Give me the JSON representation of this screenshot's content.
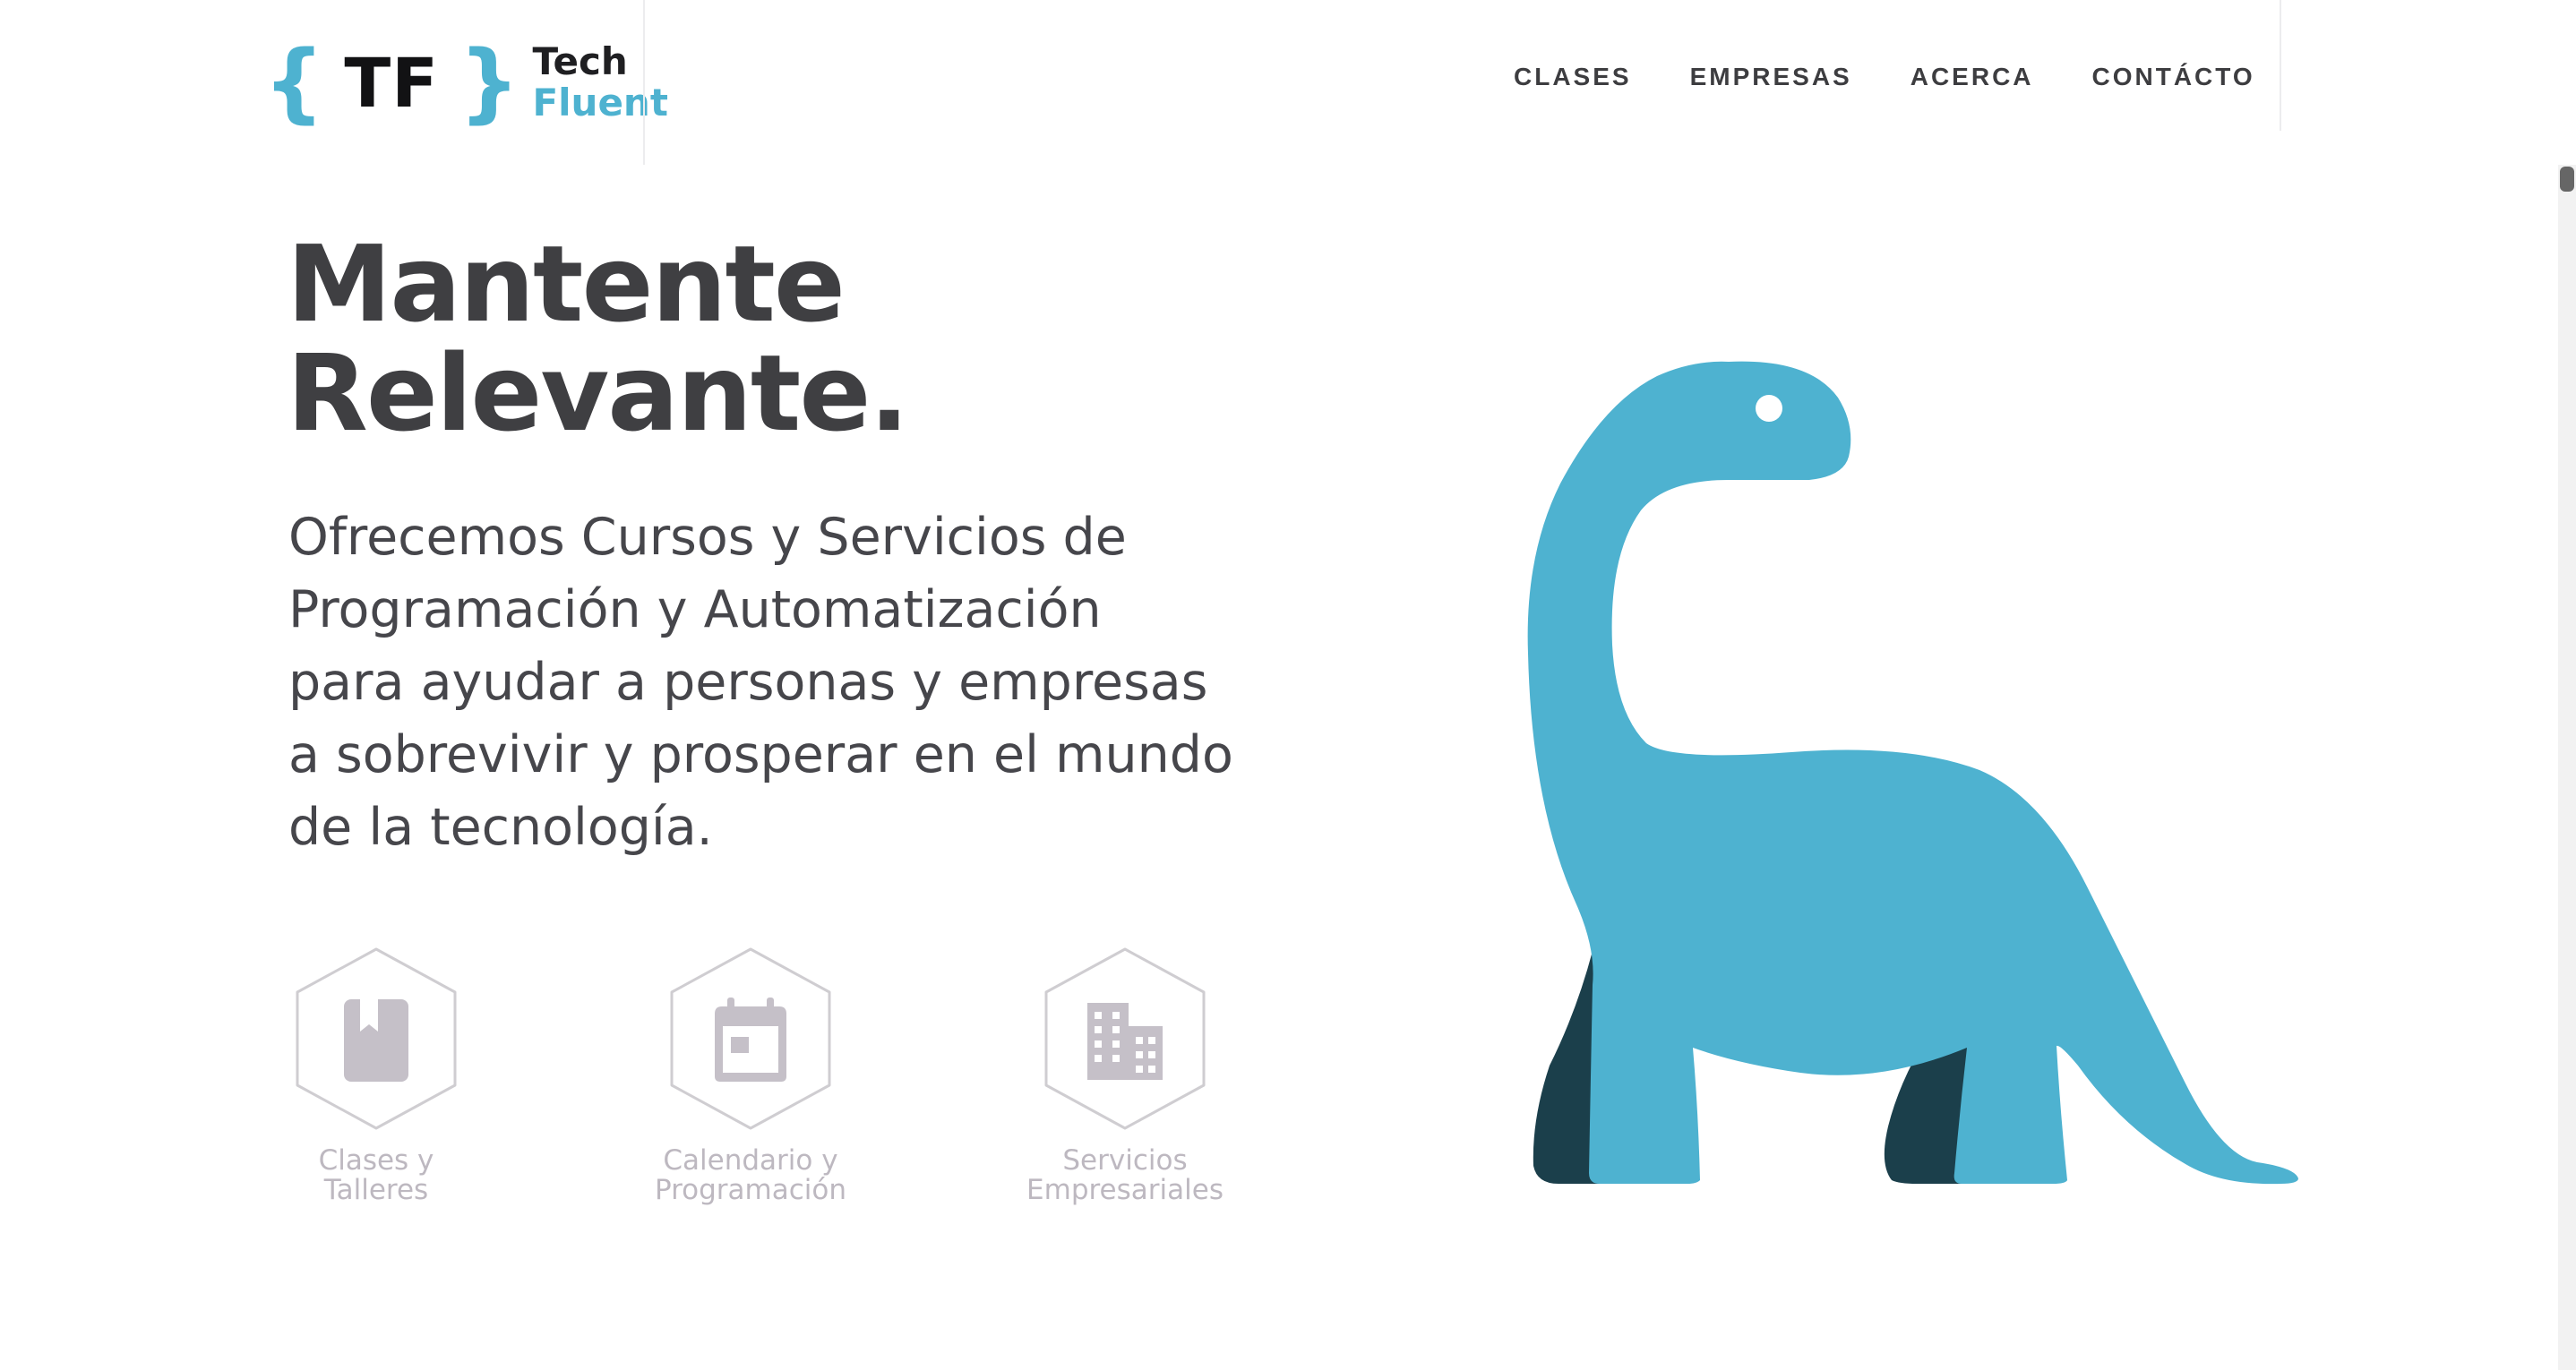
{
  "brand": {
    "mark": "TF",
    "open_brace": "{",
    "close_brace": "}",
    "word_top": "Tech",
    "word_bottom": "Fluent",
    "accent_color": "#4eb2d0",
    "dark_color": "#1b3f4b"
  },
  "nav": {
    "items": [
      {
        "label": "CLASES"
      },
      {
        "label": "EMPRESAS"
      },
      {
        "label": "ACERCA"
      },
      {
        "label": "CONTÁCTO"
      }
    ]
  },
  "hero": {
    "title_line1": "Mantente",
    "title_line2": "Relevante.",
    "description_lines": [
      "Ofrecemos Cursos y Servicios de",
      "Programación y Automatización",
      "para ayudar a personas y empresas",
      "a sobrevivir y prosperar en el mundo",
      "de la tecnología."
    ]
  },
  "services": [
    {
      "icon": "book-icon",
      "label_line1": "Clases y",
      "label_line2": "Talleres"
    },
    {
      "icon": "calendar-icon",
      "label_line1": "Calendario y",
      "label_line2": "Programación"
    },
    {
      "icon": "building-icon",
      "label_line1": "Servicios",
      "label_line2": "Empresariales"
    }
  ],
  "illustration": {
    "subject": "dinosaur-illustration"
  }
}
